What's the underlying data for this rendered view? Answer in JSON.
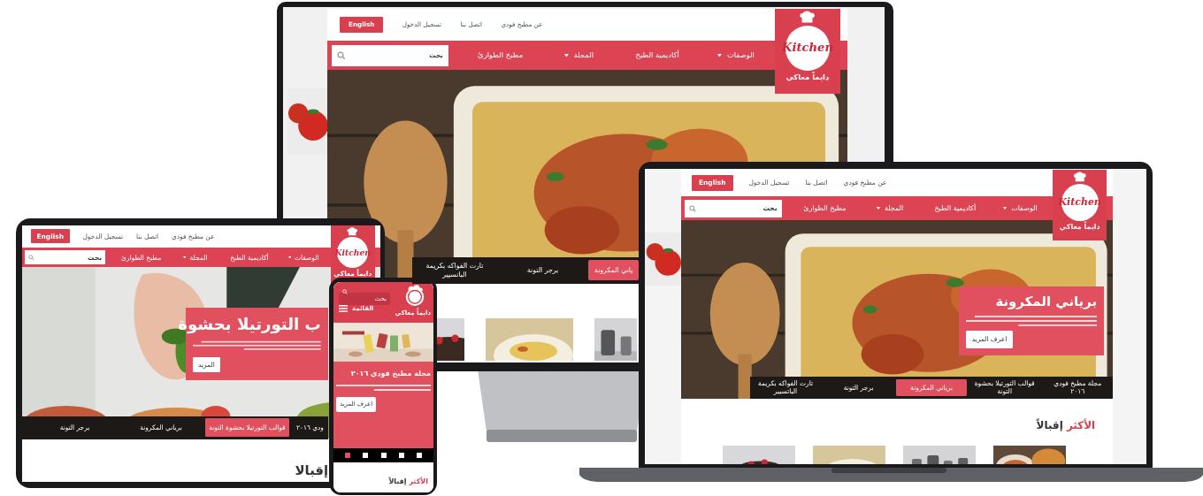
{
  "devices": [
    {
      "kind": "monitor",
      "top_links": [
        "عن مطبخ فودي",
        "اتصل بنا",
        "تسجيل الدخول"
      ],
      "language_button": "English",
      "nav": [
        {
          "label": "الوصفات",
          "dropdown": true
        },
        {
          "label": "أكاديمية الطبخ",
          "dropdown": false
        },
        {
          "label": "المجلة",
          "dropdown": true
        },
        {
          "label": "مطبخ الطوارئ",
          "dropdown": false
        }
      ],
      "search": {
        "placeholder": "بحث"
      },
      "logo": {
        "wordmark": "Kitchen",
        "tagline": "دايماً معاكي"
      },
      "slider_tabs": [
        {
          "label": "ياني المكرونة",
          "selected": true
        },
        {
          "label": "برجر التونة",
          "selected": false
        },
        {
          "label": "تارت الفواكه بكريمة الباتسيير",
          "selected": false
        }
      ],
      "thumbnails": [
        {
          "kind": "picture"
        },
        {
          "kind": "picture"
        },
        {
          "kind": "picture"
        }
      ]
    },
    {
      "kind": "laptop",
      "top_links": [
        "عن مطبخ فودي",
        "اتصل بنا",
        "تسجيل الدخول"
      ],
      "language_button": "English",
      "nav": [
        {
          "label": "الوصفات",
          "dropdown": true
        },
        {
          "label": "أكاديمية الطبخ",
          "dropdown": false
        },
        {
          "label": "المجلة",
          "dropdown": true
        },
        {
          "label": "مطبخ الطوارئ",
          "dropdown": false
        }
      ],
      "search": {
        "placeholder": "بحث"
      },
      "logo": {
        "wordmark": "Kitchen",
        "tagline": "دايماً معاكي"
      },
      "slide": {
        "title": "برياني المكرونة",
        "button": "اعرف المزيد"
      },
      "slider_tabs": [
        {
          "label": "مجلة مطبخ فودي ٢٠١٦",
          "selected": false
        },
        {
          "label": "قوالب التورتيلا بحشوة التونة",
          "selected": false
        },
        {
          "label": "برياني المكرونة",
          "selected": true
        },
        {
          "label": "برجر التونة",
          "selected": false
        },
        {
          "label": "تارت الفواكه بكريمة الباتسيير",
          "selected": false
        }
      ],
      "heading": {
        "accent": "الأكثر",
        "rest": "إقبالاً"
      },
      "thumbnails": [
        {
          "kind": "picture"
        },
        {
          "kind": "picture"
        },
        {
          "kind": "picture"
        },
        {
          "kind": "picture"
        }
      ]
    },
    {
      "kind": "tablet",
      "top_links": [
        "عن مطبخ فودي",
        "اتصل بنا",
        "تسجيل الدخول"
      ],
      "language_button": "English",
      "nav": [
        {
          "label": "الوصفات",
          "dropdown": true
        },
        {
          "label": "أكاديمية الطبخ",
          "dropdown": false
        },
        {
          "label": "المجلة",
          "dropdown": true
        },
        {
          "label": "مطبخ الطوارئ",
          "dropdown": false
        }
      ],
      "search": {
        "placeholder": "بحث"
      },
      "logo": {
        "wordmark": "Kitchen",
        "tagline": "دايماً معاكي"
      },
      "slide": {
        "title": "ب التورتيلا بحشوة",
        "button": "المزيد"
      },
      "slider_tabs": [
        {
          "label": "ودي ٢٠١٦",
          "selected": false
        },
        {
          "label": "قوالب التورتيلا بحشوة التونة",
          "selected": true
        },
        {
          "label": "برياني المكرونة",
          "selected": false
        },
        {
          "label": "برجر التونة",
          "selected": false
        }
      ],
      "heading": {
        "rest": "إقبالا"
      }
    },
    {
      "kind": "phone",
      "search": {
        "placeholder": "بحث"
      },
      "menu_label": "القائمة",
      "logo": {
        "tagline": "دايماً معاكي"
      },
      "slide": {
        "title": "مجلة مطبخ فودي ٢٠١٦",
        "button": "اعرف المزيد"
      },
      "slider_dots": [
        {
          "selected": false
        },
        {
          "selected": false
        },
        {
          "selected": false
        },
        {
          "selected": false
        },
        {
          "selected": true
        }
      ],
      "heading": {
        "accent": "الأكثر",
        "rest": "إقبالاً"
      }
    }
  ]
}
